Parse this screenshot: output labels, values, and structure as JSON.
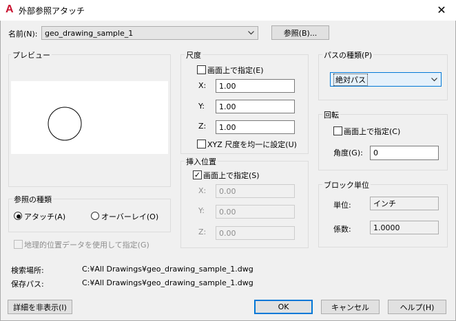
{
  "window": {
    "title": "外部参照アタッチ",
    "logo": "A",
    "close_glyph": "✕"
  },
  "name_row": {
    "label": "名前(N):",
    "value": "geo_drawing_sample_1",
    "browse": "参照(B)..."
  },
  "preview": {
    "legend": "プレビュー"
  },
  "scale": {
    "legend": "尺度",
    "on_screen": "画面上で指定(E)",
    "x_label": "X:",
    "x_value": "1.00",
    "y_label": "Y:",
    "y_value": "1.00",
    "z_label": "Z:",
    "z_value": "1.00",
    "uniform": "XYZ 尺度を均一に設定(U)"
  },
  "insertion": {
    "legend": "挿入位置",
    "on_screen": "画面上で指定(S)",
    "x_label": "X:",
    "x_value": "0.00",
    "y_label": "Y:",
    "y_value": "0.00",
    "z_label": "Z:",
    "z_value": "0.00"
  },
  "path_type": {
    "legend": "パスの種類(P)",
    "value": "絶対パス"
  },
  "rotation": {
    "legend": "回転",
    "on_screen": "画面上で指定(C)",
    "angle_label": "角度(G):",
    "angle_value": "0"
  },
  "block_unit": {
    "legend": "ブロック単位",
    "unit_label": "単位:",
    "unit_value": "インチ",
    "factor_label": "係数:",
    "factor_value": "1.0000"
  },
  "ref_type": {
    "legend": "参照の種類",
    "attach": "アタッチ(A)",
    "overlay": "オーバーレイ(O)"
  },
  "geo": {
    "label": "地理的位置データを使用して指定(G)"
  },
  "paths": {
    "found_label": "検索場所:",
    "found_value": "C:¥All Drawings¥geo_drawing_sample_1.dwg",
    "saved_label": "保存パス:",
    "saved_value": "C:¥All Drawings¥geo_drawing_sample_1.dwg"
  },
  "buttons": {
    "details": "詳細を非表示(I)",
    "ok": "OK",
    "cancel": "キャンセル",
    "help": "ヘルプ(H)"
  }
}
